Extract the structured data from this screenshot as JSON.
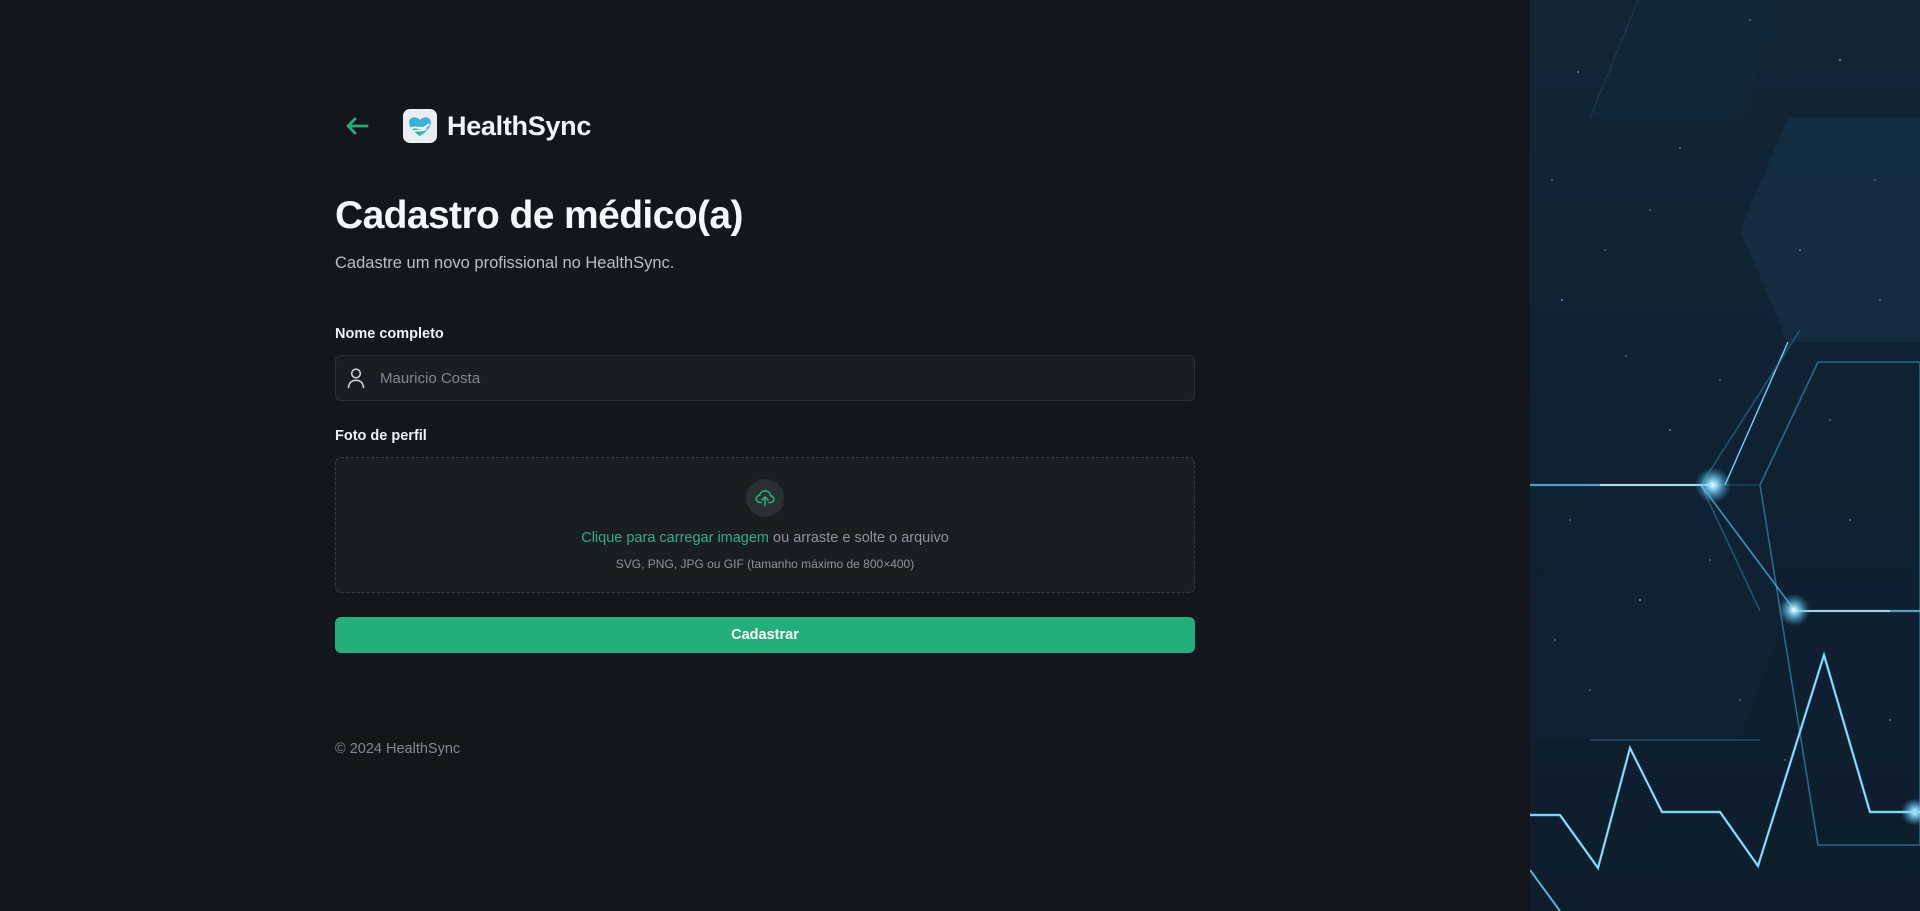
{
  "brand": {
    "name": "HealthSync"
  },
  "page": {
    "title": "Cadastro de médico(a)",
    "subtitle": "Cadastre um novo profissional no HealthSync."
  },
  "form": {
    "name_label": "Nome completo",
    "name_placeholder": "Mauricio Costa",
    "photo_label": "Foto de perfil",
    "upload_link": "Clique para carregar imagem",
    "upload_text": " ou arraste e solte o arquivo",
    "upload_hint": "SVG, PNG, JPG ou GIF (tamanho máximo de 800×400)",
    "submit_label": "Cadastrar"
  },
  "footer": {
    "copyright": "© 2024 HealthSync"
  },
  "icons": {
    "back": "arrow-left-icon",
    "logo": "heart-hand-logo",
    "user": "user-icon",
    "upload": "cloud-upload-icon"
  },
  "colors": {
    "accent": "#23af7b",
    "background": "#13171b",
    "input_bg": "#1a1d21",
    "panel": "#0f2233",
    "glow": "#5cc8f2"
  }
}
